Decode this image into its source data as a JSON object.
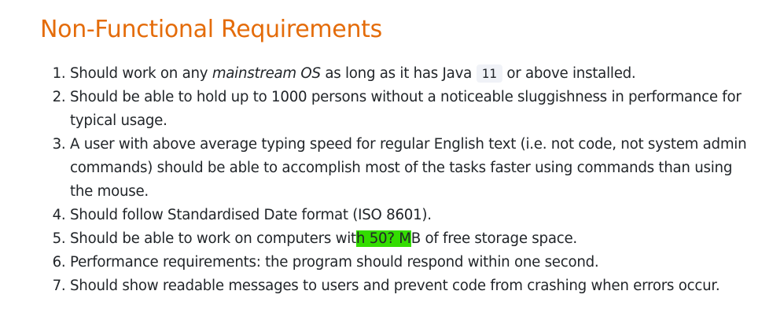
{
  "heading": "Non-Functional Requirements",
  "requirements": {
    "r1": {
      "before": "Should work on any ",
      "em": "mainstream OS",
      "middle": " as long as it has Java ",
      "code": "11",
      "after": " or above installed."
    },
    "r2": "Should be able to hold up to 1000 persons without a noticeable sluggishness in performance for typical usage.",
    "r3": "A user with above average typing speed for regular English text (i.e. not code, not system admin commands) should be able to accomplish most of the tasks faster using commands than using the mouse.",
    "r4": "Should follow Standardised Date format (ISO 8601).",
    "r5": {
      "before": "Should be able to work on computers wit",
      "highlighted": "h 50? M",
      "after": "B of free storage space."
    },
    "r6": "Performance requirements: the program should respond within one second.",
    "r7": "Should show readable messages to users and prevent code from crashing when errors occur."
  },
  "colors": {
    "heading": "#e46c0a",
    "highlight": "#33dd00",
    "code_background": "#f0f2f7"
  }
}
